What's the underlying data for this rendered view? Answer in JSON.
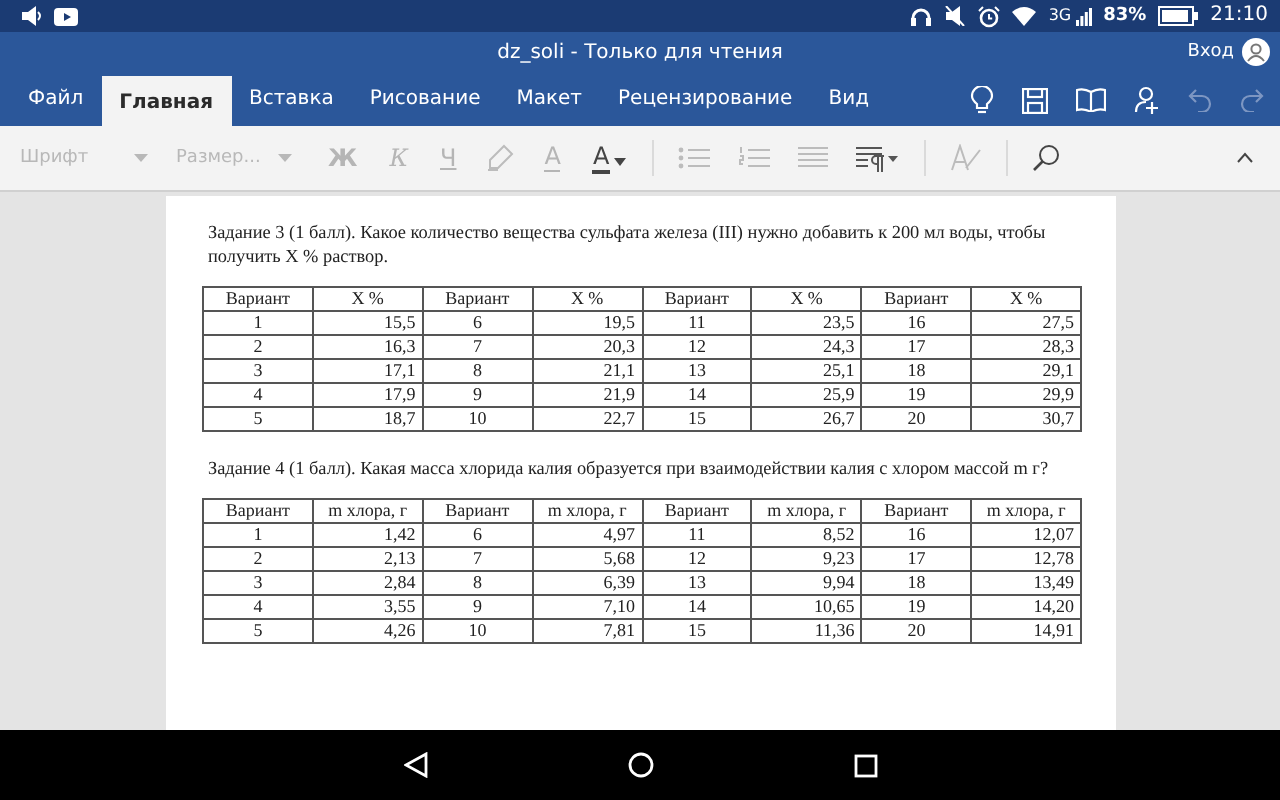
{
  "status_bar": {
    "network": "3G",
    "battery": "83%",
    "time": "21:10"
  },
  "window": {
    "title": "dz_soli - Только для чтения",
    "sign_in": "Вход"
  },
  "tabs": [
    {
      "label": "Файл",
      "selected": false
    },
    {
      "label": "Главная",
      "selected": true
    },
    {
      "label": "Вставка",
      "selected": false
    },
    {
      "label": "Рисование",
      "selected": false
    },
    {
      "label": "Макет",
      "selected": false
    },
    {
      "label": "Рецензирование",
      "selected": false
    },
    {
      "label": "Вид",
      "selected": false
    }
  ],
  "ribbon": {
    "font": {
      "placeholder": "Шрифт"
    },
    "size": {
      "placeholder": "Размер..."
    },
    "format_buttons": [
      {
        "label": "Ж",
        "kind": "bold",
        "disabled": true
      },
      {
        "label": "К",
        "kind": "italic",
        "disabled": true
      },
      {
        "label": "Ч",
        "kind": "underline",
        "disabled": true
      }
    ],
    "color_buttons": [
      {
        "label": "А",
        "kind": "highlight",
        "disabled": true
      },
      {
        "label": "А",
        "kind": "fontcolor",
        "disabled": false
      }
    ]
  },
  "document": {
    "tasks": [
      {
        "text": "Задание 3 (1 балл). Какое количество вещества сульфата железа (III) нужно добавить к 200 мл воды, чтобы получить X % раствор.",
        "table": {
          "columns": [
            "Вариант",
            "X %",
            "Вариант",
            "X %",
            "Вариант",
            "X %",
            "Вариант",
            "X %"
          ],
          "rows": [
            [
              "1",
              "15,5",
              "6",
              "19,5",
              "11",
              "23,5",
              "16",
              "27,5"
            ],
            [
              "2",
              "16,3",
              "7",
              "20,3",
              "12",
              "24,3",
              "17",
              "28,3"
            ],
            [
              "3",
              "17,1",
              "8",
              "21,1",
              "13",
              "25,1",
              "18",
              "29,1"
            ],
            [
              "4",
              "17,9",
              "9",
              "21,9",
              "14",
              "25,9",
              "19",
              "29,9"
            ],
            [
              "5",
              "18,7",
              "10",
              "22,7",
              "15",
              "26,7",
              "20",
              "30,7"
            ]
          ]
        }
      },
      {
        "text": "Задание 4 (1 балл). Какая масса хлорида калия образуется при взаимодействии калия с хлором массой m г?",
        "table": {
          "columns": [
            "Вариант",
            "m хлора, г",
            "Вариант",
            "m хлора, г",
            "Вариант",
            "m хлора, г",
            "Вариант",
            "m хлора, г"
          ],
          "rows": [
            [
              "1",
              "1,42",
              "6",
              "4,97",
              "11",
              "8,52",
              "16",
              "12,07"
            ],
            [
              "2",
              "2,13",
              "7",
              "5,68",
              "12",
              "9,23",
              "17",
              "12,78"
            ],
            [
              "3",
              "2,84",
              "8",
              "6,39",
              "13",
              "9,94",
              "18",
              "13,49"
            ],
            [
              "4",
              "3,55",
              "9",
              "7,10",
              "14",
              "10,65",
              "19",
              "14,20"
            ],
            [
              "5",
              "4,26",
              "10",
              "7,81",
              "15",
              "11,36",
              "20",
              "14,91"
            ]
          ]
        }
      }
    ]
  }
}
